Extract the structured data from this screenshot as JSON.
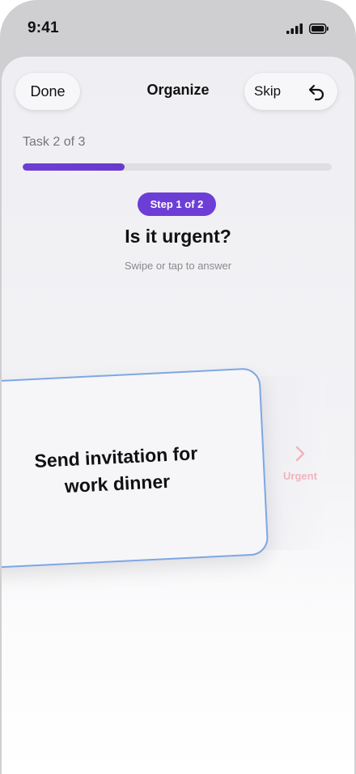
{
  "status": {
    "time": "9:41",
    "icons": [
      "signal-icon",
      "battery-icon"
    ]
  },
  "header": {
    "done_label": "Done",
    "title": "Organize",
    "skip_label": "Skip",
    "undo_icon": "undo-icon"
  },
  "progress": {
    "label": "Task 2 of 3",
    "fraction": 0.33
  },
  "step": {
    "badge": "Step 1 of 2",
    "question": "Is it urgent?",
    "hint": "Swipe or tap to answer"
  },
  "card": {
    "text": "Send invitation for work dinner"
  },
  "swipe_target": {
    "label": "Urgent",
    "icon": "chevron-right-icon",
    "color": "#f0b4bd"
  },
  "colors": {
    "accent": "#6c3ed6",
    "card_border": "#7ea6e6"
  }
}
